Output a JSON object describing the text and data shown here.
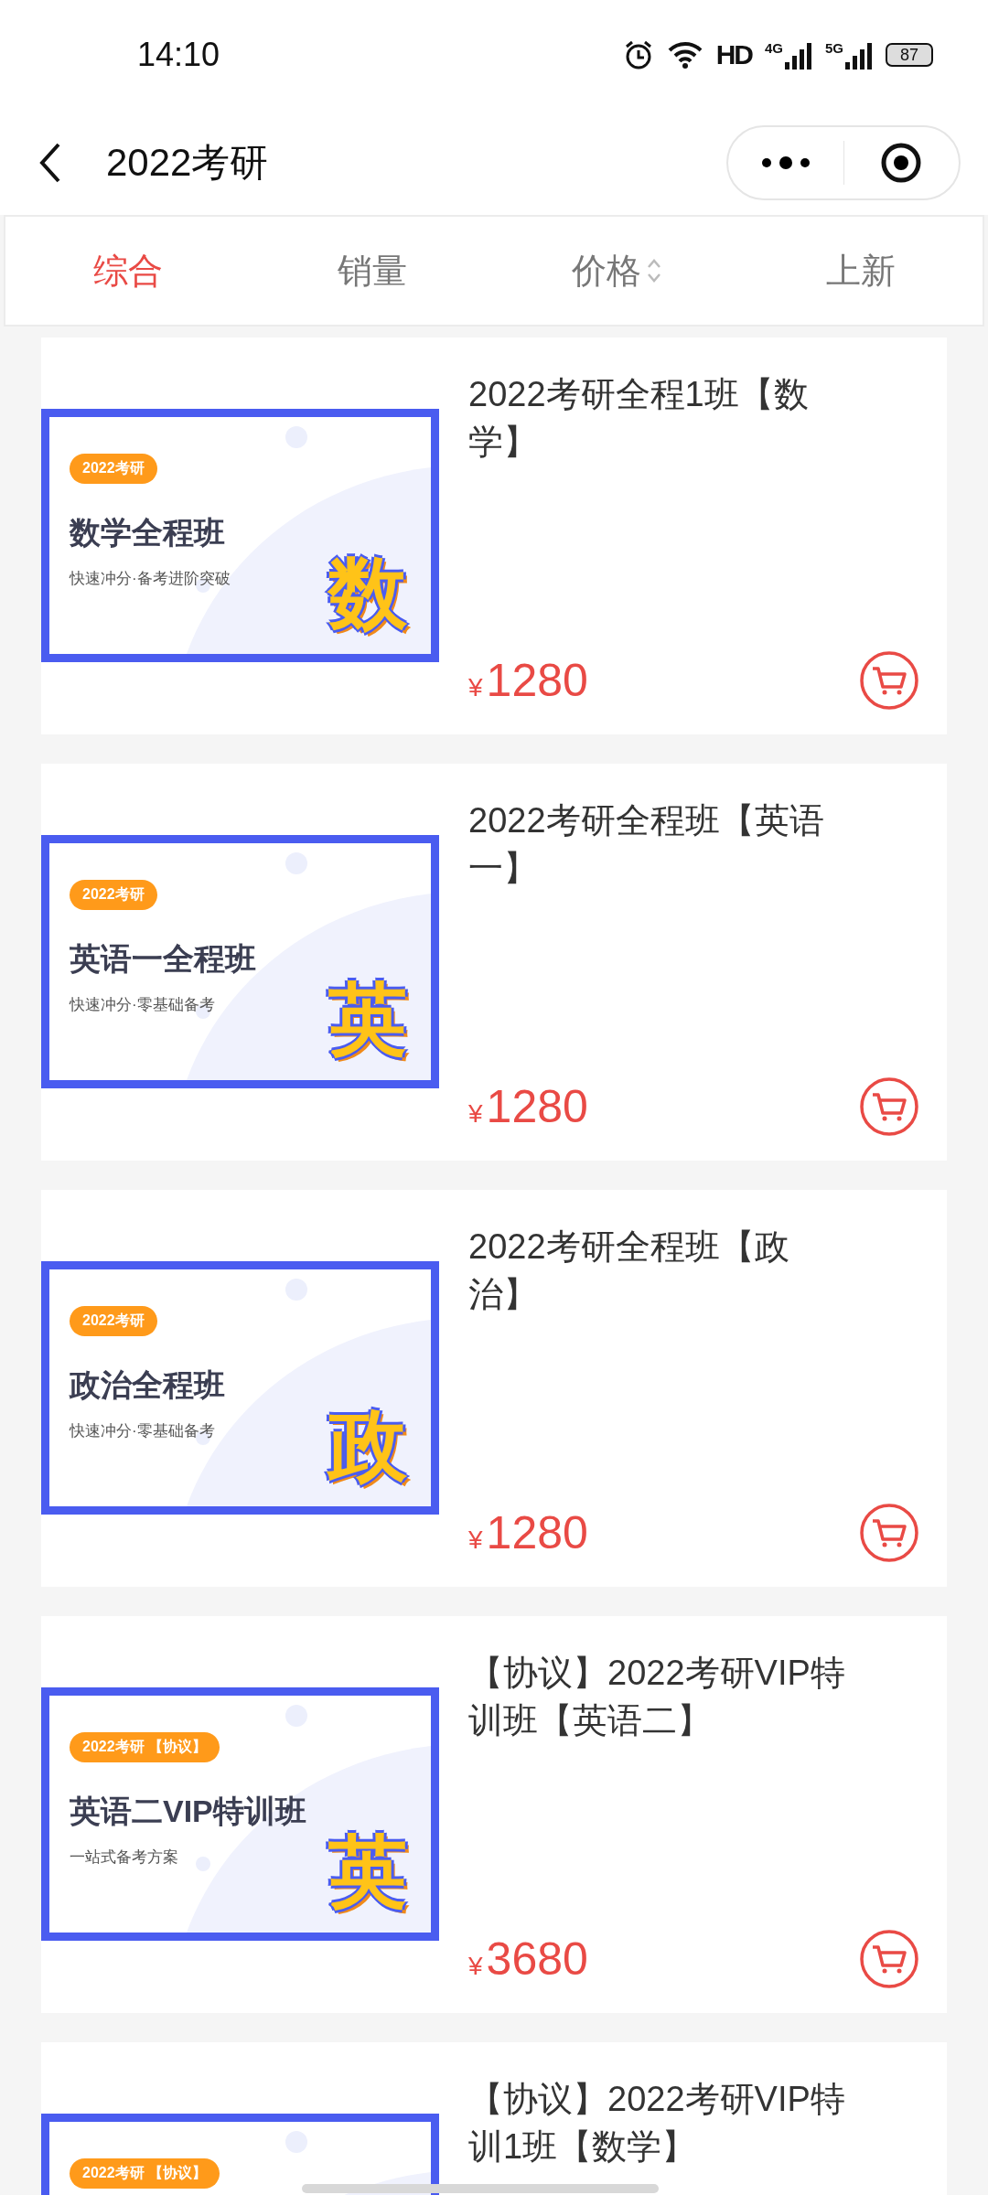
{
  "status_bar": {
    "time": "14:10",
    "hd": "HD",
    "net_1": "4G",
    "net_2": "5G",
    "battery": "87"
  },
  "nav": {
    "title": "2022考研"
  },
  "sort_tabs": [
    {
      "label": "综合",
      "selected": true,
      "kind": "plain"
    },
    {
      "label": "销量",
      "selected": false,
      "kind": "plain"
    },
    {
      "label": "价格",
      "selected": false,
      "kind": "sortable"
    },
    {
      "label": "上新",
      "selected": false,
      "kind": "plain"
    }
  ],
  "products": [
    {
      "title": "2022考研全程1班【数学】",
      "banner": {
        "tag": "2022考研",
        "heading": "数学全程班",
        "subtitle": "快速冲分·备考进阶突破",
        "glyph": "数"
      },
      "currency": "¥",
      "price": "1280"
    },
    {
      "title": "2022考研全程班【英语一】",
      "banner": {
        "tag": "2022考研",
        "heading": "英语一全程班",
        "subtitle": "快速冲分·零基础备考",
        "glyph": "英"
      },
      "currency": "¥",
      "price": "1280"
    },
    {
      "title": "2022考研全程班【政治】",
      "banner": {
        "tag": "2022考研",
        "heading": "政治全程班",
        "subtitle": "快速冲分·零基础备考",
        "glyph": "政"
      },
      "currency": "¥",
      "price": "1280"
    },
    {
      "title": "【协议】2022考研VIP特训班【英语二】",
      "banner": {
        "tag": "2022考研 【协议】",
        "heading": "英语二VIP特训班",
        "subtitle": "一站式备考方案",
        "glyph": "英"
      },
      "currency": "¥",
      "price": "3680"
    },
    {
      "title": "【协议】2022考研VIP特训1班【数学】",
      "banner": {
        "tag": "2022考研 【协议】"
      }
    }
  ]
}
